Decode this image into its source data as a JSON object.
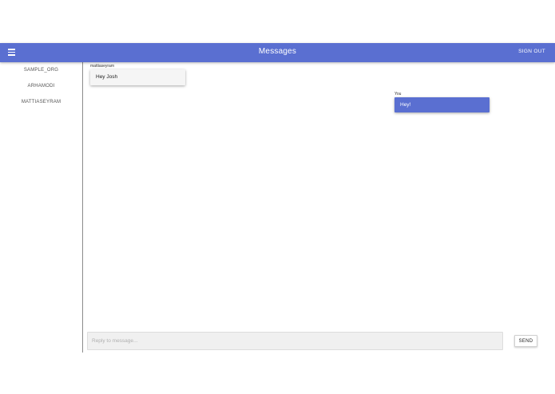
{
  "header": {
    "title": "Messages",
    "menu_icon": "hamburger-menu-icon",
    "signout_label": "SIGN OUT"
  },
  "sidebar": {
    "items": [
      {
        "label": "SAMPLE_ORG"
      },
      {
        "label": "ARHAMODI"
      },
      {
        "label": "MATTIASEYRAM"
      }
    ]
  },
  "messages": [
    {
      "author": "mattiaseyram",
      "text": "Hey Josh",
      "direction": "incoming"
    },
    {
      "author": "You",
      "text": "Hey!",
      "direction": "outgoing"
    }
  ],
  "composer": {
    "placeholder": "Reply to message...",
    "send_label": "SEND"
  },
  "colors": {
    "primary": "#5a6fd1",
    "incoming_bubble": "#f5f5f5",
    "divider": "#8c8c8c"
  }
}
